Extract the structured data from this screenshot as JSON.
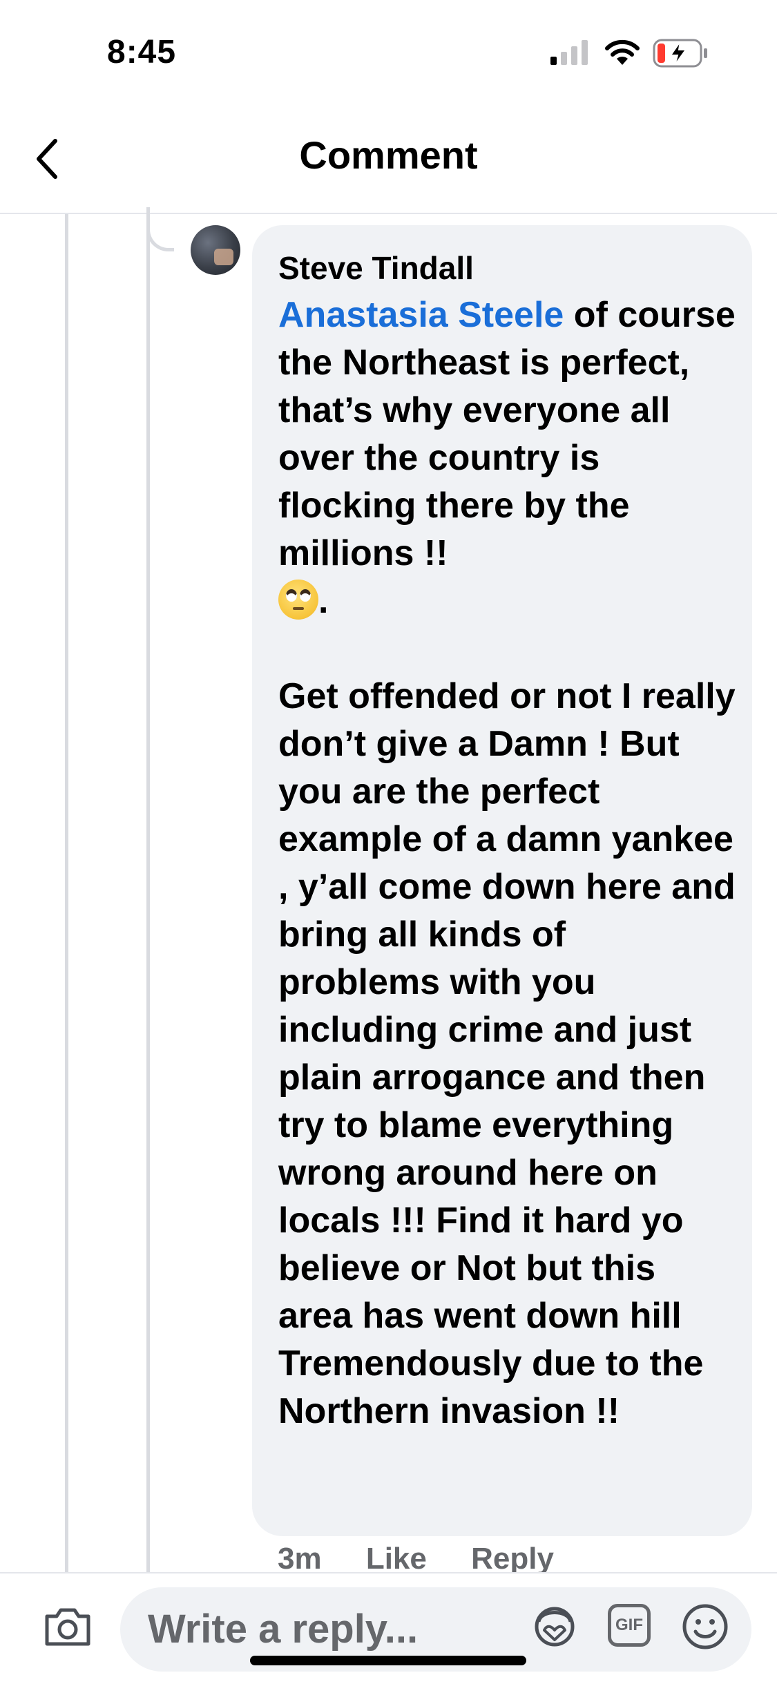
{
  "status_bar": {
    "time": "8:45"
  },
  "nav": {
    "title": "Comment"
  },
  "comment": {
    "author": "Steve Tindall",
    "mention": "Anastasia Steele",
    "text_after_mention": "  of course the Northeast is perfect, that’s why everyone all over the country is flocking there by the millions !!",
    "emoji": "eye-roll",
    "text_after_emoji": ".",
    "paragraph_2": "Get offended or not I really don’t give a Damn ! But you are the perfect example of a damn yankee , y’all come down here and bring all kinds of problems with you including crime and just plain arrogance and then try to blame everything wrong around here on locals !!! Find it hard yo believe or Not but this area has went down hill Tremendously due to the Northern invasion !!",
    "time_ago": "3m",
    "like_label": "Like",
    "reply_label": "Reply"
  },
  "reply_bar": {
    "placeholder": "Write a reply...",
    "gif_label": "GIF"
  },
  "colors": {
    "mention": "#1a6ed8",
    "bubble": "#f0f2f5",
    "muted": "#65676b"
  }
}
